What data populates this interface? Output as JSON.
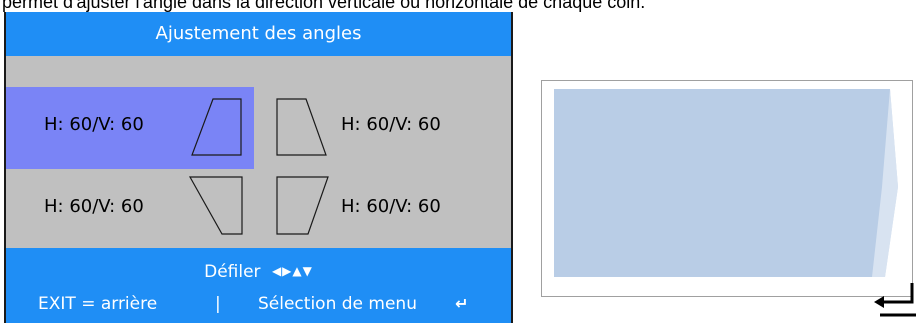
{
  "caption_cut": "permet d'ajuster l'angle dans la direction verticale ou horizontale de chaque coin.",
  "osd": {
    "title": "Ajustement des angles",
    "cells": [
      {
        "label": "H: 60/V: 60",
        "corner": "top-left",
        "selected": true
      },
      {
        "label": "H: 60/V: 60",
        "corner": "top-right",
        "selected": false
      },
      {
        "label": "H: 60/V: 60",
        "corner": "bottom-left",
        "selected": false
      },
      {
        "label": "H: 60/V: 60",
        "corner": "bottom-right",
        "selected": false
      }
    ],
    "footer": {
      "scroll_label": "Défiler",
      "scroll_icons": "◀▶▲▼",
      "exit_label": "EXIT = arrière",
      "separator": "|",
      "menu_label": "Sélection de menu",
      "enter_icon": "↵"
    }
  },
  "colors": {
    "osd_blue": "#1f8ef5",
    "osd_gray": "#c0c0c0",
    "selected_cell": "#7a84f6",
    "preview_fill": "#b9cde6"
  }
}
